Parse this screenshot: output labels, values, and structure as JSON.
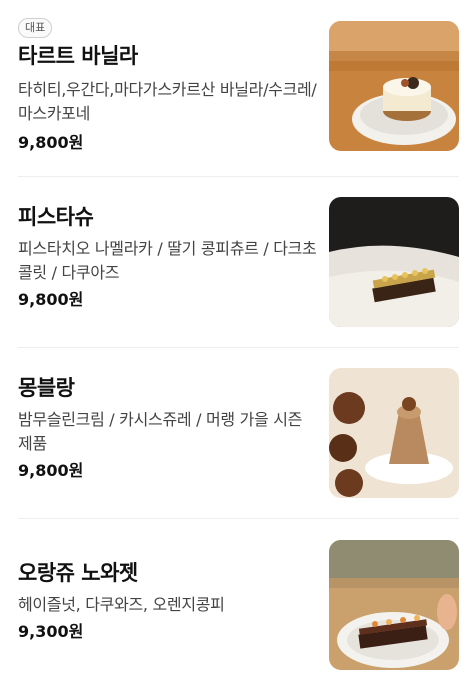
{
  "menu": {
    "items": [
      {
        "badge": "대표",
        "name": "타르트 바닐라",
        "description": "타히티,우간다,마다가스카르산 바닐라/수크레/마스카포네",
        "price": "9,800원",
        "image": "vanilla-tart-photo"
      },
      {
        "name": "피스타슈",
        "description": "피스타치오 나멜라카 / 딸기 콩피츄르 / 다크초콜릿 / 다쿠아즈",
        "price": "9,800원",
        "image": "pistachio-cake-photo"
      },
      {
        "name": "몽블랑",
        "description": "밤무슬린크림 / 카시스쥬레 / 머랭 가을 시즌 제품",
        "price": "9,800원",
        "image": "mont-blanc-photo"
      },
      {
        "name": "오랑쥬 노와젯",
        "description": "헤이즐넛, 다쿠와즈, 오렌지콩피",
        "price": "9,300원",
        "image": "orange-noisette-photo"
      }
    ]
  }
}
